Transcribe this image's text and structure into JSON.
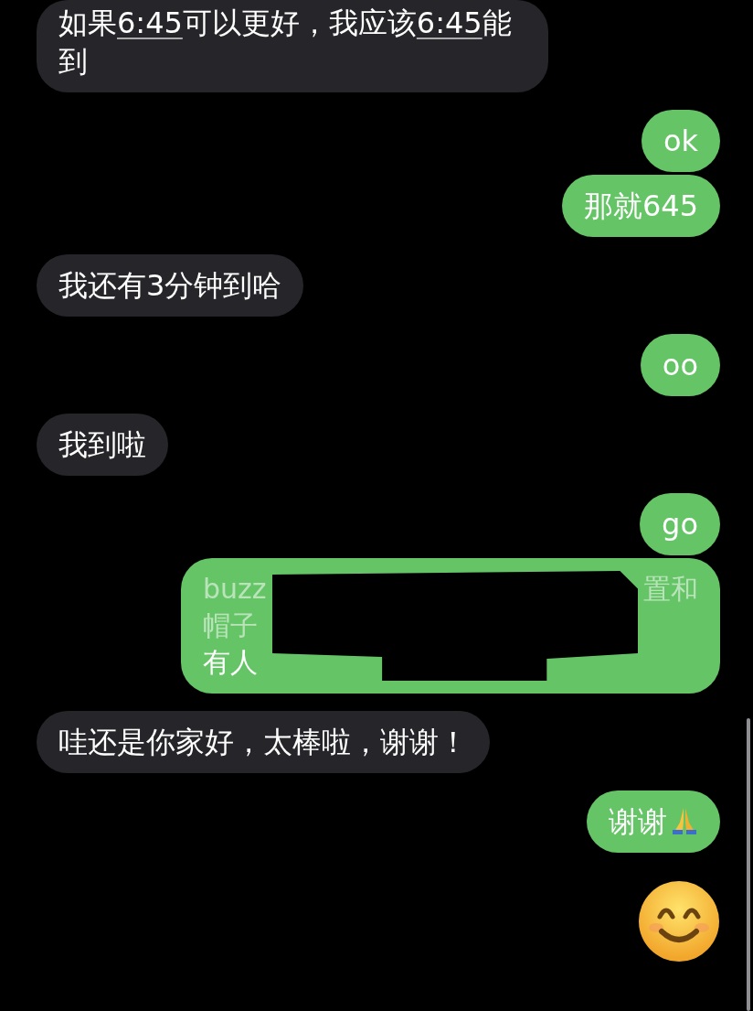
{
  "messages": [
    {
      "outgoing": false,
      "kind": "text",
      "segments": [
        {
          "kind": "text",
          "text": "如果"
        },
        {
          "kind": "link",
          "text": "6:45"
        },
        {
          "kind": "text",
          "text": "可以更好，我应该"
        },
        {
          "kind": "link",
          "text": "6:45"
        },
        {
          "kind": "text",
          "text": "能到"
        }
      ]
    },
    {
      "outgoing": true,
      "kind": "text",
      "segments": [
        {
          "kind": "text",
          "text": "ok"
        }
      ]
    },
    {
      "outgoing": true,
      "kind": "text",
      "segments": [
        {
          "kind": "text",
          "text": "那就645"
        }
      ]
    },
    {
      "outgoing": false,
      "kind": "text",
      "segments": [
        {
          "kind": "text",
          "text": "我还有3分钟到哈"
        }
      ]
    },
    {
      "outgoing": true,
      "kind": "text",
      "segments": [
        {
          "kind": "text",
          "text": "oo"
        }
      ]
    },
    {
      "outgoing": false,
      "kind": "text",
      "segments": [
        {
          "kind": "text",
          "text": "我到啦"
        }
      ]
    },
    {
      "outgoing": true,
      "kind": "text",
      "segments": [
        {
          "kind": "text",
          "text": "go"
        }
      ]
    },
    {
      "outgoing": true,
      "kind": "redacted",
      "lines": [
        {
          "left": "buzz",
          "right": "置和",
          "faded": true
        },
        {
          "left": "帽子",
          "faded": true
        },
        {
          "left": "有人",
          "faded": false
        }
      ]
    },
    {
      "outgoing": false,
      "kind": "text",
      "segments": [
        {
          "kind": "text",
          "text": "哇还是你家好，太棒啦，谢谢！"
        }
      ]
    },
    {
      "outgoing": true,
      "kind": "text",
      "segments": [
        {
          "kind": "text",
          "text": "谢谢"
        },
        {
          "kind": "emoji"
        }
      ]
    },
    {
      "outgoing": true,
      "kind": "emoji"
    }
  ]
}
